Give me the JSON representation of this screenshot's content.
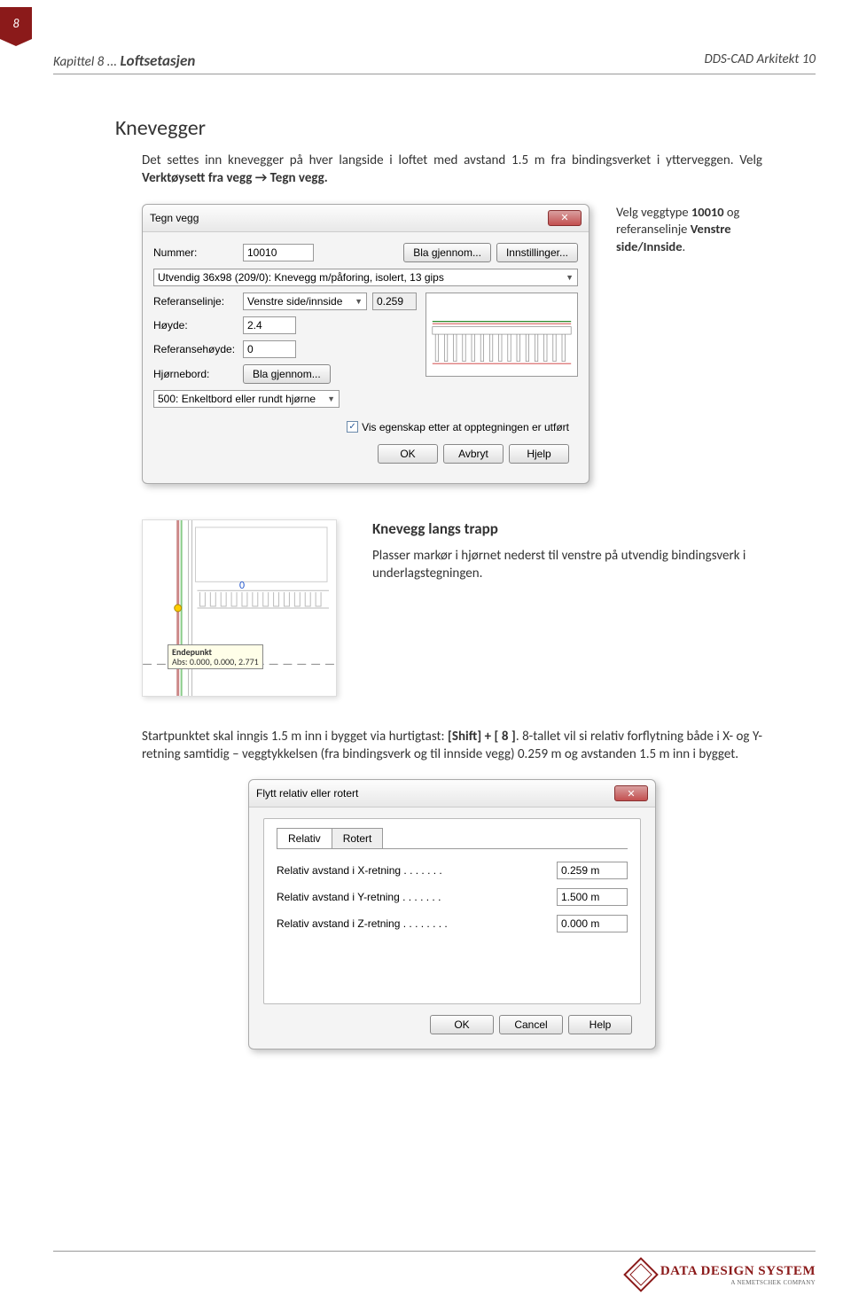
{
  "page_number": "8",
  "header": {
    "chapter": "Kapittel 8 ...",
    "title": "Loftsetasjen",
    "product": "DDS-CAD Arkitekt 10"
  },
  "section1": {
    "heading": "Knevegger",
    "para_before": "Det settes inn knevegger på hver langside i loftet med avstand 1.5 m fra bindingsverket i ytterveggen. Velg ",
    "para_bold": "Verktøysett fra vegg → Tegn vegg.",
    "sidenote_p1": "Velg veggtype ",
    "sidenote_b1": "10010",
    "sidenote_p2": " og referanselinje ",
    "sidenote_b2": "Venstre side/Innside",
    "sidenote_p3": "."
  },
  "dialog1": {
    "title": "Tegn vegg",
    "nummer_label": "Nummer:",
    "nummer_value": "10010",
    "bla_gjennom": "Bla gjennom...",
    "innstillinger": "Innstillinger...",
    "type_desc": "Utvendig 36x98 (209/0): Knevegg m/påforing, isolert, 13 gips",
    "ref_label": "Referanselinje:",
    "ref_value": "Venstre side/innside",
    "ref_num": "0.259",
    "hoyde_label": "Høyde:",
    "hoyde_value": "2.4",
    "refh_label": "Referansehøyde:",
    "refh_value": "0",
    "hjorne_label": "Hjørnebord:",
    "hjorne_btn": "Bla gjennom...",
    "hjorne_combo": "500: Enkeltbord eller rundt hjørne",
    "checkbox": "Vis egenskap etter at opptegningen er utført",
    "ok": "OK",
    "cancel": "Avbryt",
    "help": "Hjelp"
  },
  "section2": {
    "heading": "Knevegg langs trapp",
    "para": "Plasser markør i hjørnet nederst til venstre på utvendig bindingsverk i underlagstegningen.",
    "tooltip_title": "Endepunkt",
    "tooltip_sub": "Abs: 0.000, 0.000, 2.771",
    "zero": "0"
  },
  "section3": {
    "p1": "Startpunktet skal inngis 1.5 m inn i bygget via hurtigtast: ",
    "b1": "[Shift] + [ 8 ]",
    "p2": ".\n8-tallet vil si relativ forflytning både i X- og Y-retning samtidig – veggtykkelsen (fra bindingsverk og til innside vegg) 0.259 m og avstanden 1.5 m inn i bygget."
  },
  "dialog2": {
    "title": "Flytt relativ eller rotert",
    "tab1": "Relativ",
    "tab2": "Rotert",
    "row1_label": "Relativ avstand i X-retning . . . . . . .",
    "row1_val": "0.259 m",
    "row2_label": "Relativ avstand i Y-retning . . . . . . .",
    "row2_val": "1.500 m",
    "row3_label": "Relativ avstand i Z-retning . . . . . . . .",
    "row3_val": "0.000 m",
    "ok": "OK",
    "cancel": "Cancel",
    "help": "Help"
  },
  "footer": {
    "brand": "DATA DESIGN SYSTEM",
    "sub": "A NEMETSCHEK COMPANY"
  }
}
